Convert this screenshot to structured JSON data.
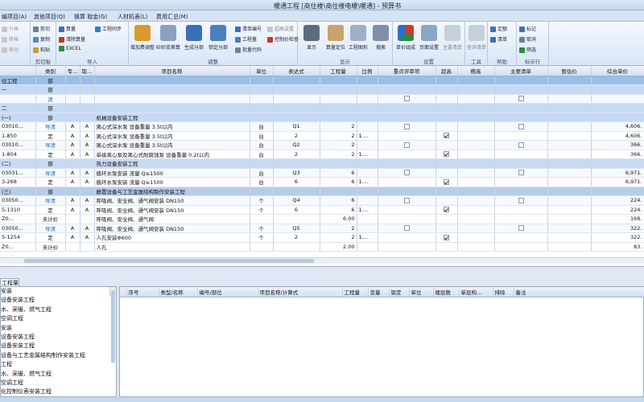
{
  "title": "暖通工程 [商住楼\\商住楼电暖\\暖通] - 预算书",
  "menu_tabs": [
    "编项目(A)",
    "其他项目(Q)",
    "换算 取金(G)",
    "人材机表(L)",
    "费用汇总(M)"
  ],
  "ribbon": {
    "g1": {
      "items": [
        "升格",
        "降格",
        "移动"
      ],
      "label": ""
    },
    "g2": {
      "items": [
        "剪切",
        "复制",
        "粘贴"
      ],
      "label": "剪切板"
    },
    "g3": {
      "items": [
        "算量",
        "清除算量",
        "EXCEL",
        "工程同步"
      ],
      "label": "导入"
    },
    "g4": {
      "items": [
        "增加费调整",
        "砼砂浆换算",
        "生成分部",
        "锁定分部",
        "清单编号",
        "工程量",
        "批量代码",
        "超高设置",
        "控制价检查"
      ],
      "label": "调整"
    },
    "g5": {
      "items": [
        "显示",
        "算量定位",
        "工程图形",
        "搜索"
      ],
      "label": "显示"
    },
    "g6": {
      "items": [
        "单价组成",
        "页面设置",
        "主要清单"
      ],
      "label": "设置"
    },
    "g7": {
      "items": [
        "查询清单"
      ],
      "label": "工具"
    },
    "g8": {
      "items": [
        "定额",
        "清单"
      ],
      "label": "帮助"
    },
    "g9": {
      "items": [
        "标记",
        "取消",
        "筛选"
      ],
      "label": "标示行"
    }
  },
  "grid": {
    "headers": [
      "",
      "类别",
      "专...",
      "取...",
      "项目名称",
      "单位",
      "表达式",
      "工程量",
      "比例",
      "重点评审项",
      "超高",
      "檐高",
      "主要清单",
      "暂估价",
      "综合单价"
    ],
    "rows": [
      {
        "style": "hl",
        "code": "位工程",
        "cat": "部",
        "a": "",
        "b": "",
        "name": "",
        "unit": "",
        "expr": "",
        "qty": "",
        "ratio": "",
        "key": "",
        "chao": "",
        "yan": "",
        "main": "",
        "est": "",
        "price": ""
      },
      {
        "style": "blue",
        "code": "一",
        "cat": "部",
        "a": "",
        "b": "",
        "name": "",
        "unit": "",
        "expr": "",
        "qty": "",
        "ratio": "",
        "key": "",
        "chao": "",
        "yan": "",
        "main": "",
        "est": "",
        "price": ""
      },
      {
        "style": "sub",
        "code": "",
        "cat": "清",
        "a": "",
        "b": "",
        "name": "",
        "unit": "",
        "expr": "",
        "qty": "",
        "ratio": "",
        "key": "box",
        "chao": "",
        "yan": "",
        "main": "box",
        "est": "",
        "price": ""
      },
      {
        "style": "blue",
        "code": "二",
        "cat": "部",
        "a": "",
        "b": "",
        "name": "",
        "unit": "",
        "expr": "",
        "qty": "",
        "ratio": "",
        "key": "",
        "chao": "",
        "yan": "",
        "main": "",
        "est": "",
        "price": ""
      },
      {
        "style": "blue",
        "code": "(一)",
        "cat": "部",
        "a": "",
        "b": "",
        "name": "机械设备安装工程",
        "unit": "",
        "expr": "",
        "qty": "",
        "ratio": "",
        "key": "",
        "chao": "",
        "yan": "",
        "main": "",
        "est": "",
        "price": ""
      },
      {
        "style": "sub",
        "code": "03010...",
        "cat": "导清",
        "a": "A",
        "b": "A",
        "name": "离心式深水泵 设备重量 3.5t以内",
        "unit": "台",
        "expr": "Q1",
        "qty": "2",
        "ratio": "",
        "key": "box",
        "chao": "",
        "yan": "",
        "main": "box",
        "est": "",
        "price": "4,606."
      },
      {
        "style": "red",
        "code": "1-850",
        "cat": "定",
        "a": "A",
        "b": "A",
        "name": "离心式深水泵 设备重量 3.5t以内",
        "unit": "台",
        "expr": "2",
        "qty": "2",
        "ratio": "1....",
        "key": "",
        "chao": "on",
        "yan": "",
        "main": "",
        "est": "",
        "price": "4,606."
      },
      {
        "style": "sub",
        "code": "03010...",
        "cat": "导清",
        "a": "A",
        "b": "A",
        "name": "离心式深水泵 设备重量 3.5t以内",
        "unit": "台",
        "expr": "Q2",
        "qty": "2",
        "ratio": "",
        "key": "box",
        "chao": "",
        "yan": "",
        "main": "box",
        "est": "",
        "price": "366."
      },
      {
        "style": "red",
        "code": "1-804",
        "cat": "定",
        "a": "A",
        "b": "A",
        "name": "单级离心泵及离心式耐腐蚀泵 设备重量 0.2t以内",
        "unit": "台",
        "expr": "2",
        "qty": "2",
        "ratio": "1....",
        "key": "",
        "chao": "on",
        "yan": "",
        "main": "",
        "est": "",
        "price": "366."
      },
      {
        "style": "blue",
        "code": "(二)",
        "cat": "部",
        "a": "",
        "b": "",
        "name": "热力设备安装工程",
        "unit": "",
        "expr": "",
        "qty": "",
        "ratio": "",
        "key": "",
        "chao": "",
        "yan": "",
        "main": "",
        "est": "",
        "price": ""
      },
      {
        "style": "sub",
        "code": "03031...",
        "cat": "导清",
        "a": "A",
        "b": "A",
        "name": "循环水泵安装 流量 Q≤1500",
        "unit": "台",
        "expr": "Q3",
        "qty": "6",
        "ratio": "",
        "key": "box",
        "chao": "",
        "yan": "",
        "main": "box",
        "est": "",
        "price": "6,971."
      },
      {
        "style": "red",
        "code": "3-268",
        "cat": "定",
        "a": "A",
        "b": "A",
        "name": "循环水泵安装 流量 Q≤1500",
        "unit": "台",
        "expr": "6",
        "qty": "6",
        "ratio": "1....",
        "key": "",
        "chao": "on",
        "yan": "",
        "main": "",
        "est": "",
        "price": "6,971."
      },
      {
        "style": "dark",
        "code": "(三)",
        "cat": "部",
        "a": "",
        "b": "",
        "name": "静置设备与工艺金属结构制作安装工程",
        "unit": "",
        "expr": "",
        "qty": "",
        "ratio": "",
        "key": "",
        "chao": "",
        "yan": "",
        "main": "",
        "est": "",
        "price": ""
      },
      {
        "style": "sub",
        "code": "03050...",
        "cat": "导清",
        "a": "A",
        "b": "A",
        "name": "呼吸阀、安全阀、通气阀安装 DN150",
        "unit": "个",
        "expr": "Q4",
        "qty": "6",
        "ratio": "",
        "key": "box",
        "chao": "",
        "yan": "",
        "main": "box",
        "est": "",
        "price": "224."
      },
      {
        "style": "red",
        "code": "5-1310",
        "cat": "定",
        "a": "A",
        "b": "A",
        "name": "呼吸阀、安全阀、通气阀安装 DN150",
        "unit": "个",
        "expr": "6",
        "qty": "6",
        "ratio": "1....",
        "key": "",
        "chao": "on",
        "yan": "",
        "main": "",
        "est": "",
        "price": "224."
      },
      {
        "style": "grn",
        "code": "Z0...",
        "cat": "未计价",
        "a": "",
        "b": "",
        "name": "呼吸阀、安全阀、通气阀",
        "unit": "",
        "expr": "",
        "qty": "6.00",
        "ratio": "",
        "key": "",
        "chao": "",
        "yan": "",
        "main": "",
        "est": "",
        "price": "168."
      },
      {
        "style": "sub",
        "code": "03050...",
        "cat": "导清",
        "a": "A",
        "b": "A",
        "name": "呼吸阀、安全阀、通气阀安装 DN150",
        "unit": "个",
        "expr": "Q5",
        "qty": "2",
        "ratio": "",
        "key": "box",
        "chao": "",
        "yan": "",
        "main": "box",
        "est": "",
        "price": "322."
      },
      {
        "style": "red",
        "code": "5-1254",
        "cat": "定",
        "a": "A",
        "b": "A",
        "name": "人孔安装Φ600",
        "unit": "个",
        "expr": "2",
        "qty": "2",
        "ratio": "1....",
        "key": "",
        "chao": "on",
        "yan": "",
        "main": "",
        "est": "",
        "price": "322."
      },
      {
        "style": "grn",
        "code": "Z0...",
        "cat": "未计价",
        "a": "",
        "b": "",
        "name": "人孔",
        "unit": "",
        "expr": "",
        "qty": "2.00",
        "ratio": "",
        "key": "",
        "chao": "",
        "yan": "",
        "main": "",
        "est": "",
        "price": "83."
      }
    ]
  },
  "lower_label": "工程量",
  "tree": [
    "安装",
    "设备安装工程",
    "水、采暖、燃气工程",
    "空调工程",
    "安装",
    "设备安装工程",
    "设备安装工程",
    "设备与工艺金属结构制作安装工程",
    "工程",
    "水、采暖、燃气工程",
    "空调工程",
    "化控制仪表安装工程"
  ],
  "detail_headers": [
    "序号",
    "类型/名称",
    "编号/部位",
    "项目名称/计算式",
    "工程量",
    "变量",
    "锁定",
    "单位",
    "楼层数",
    "单层构...",
    "排除",
    "备注"
  ]
}
